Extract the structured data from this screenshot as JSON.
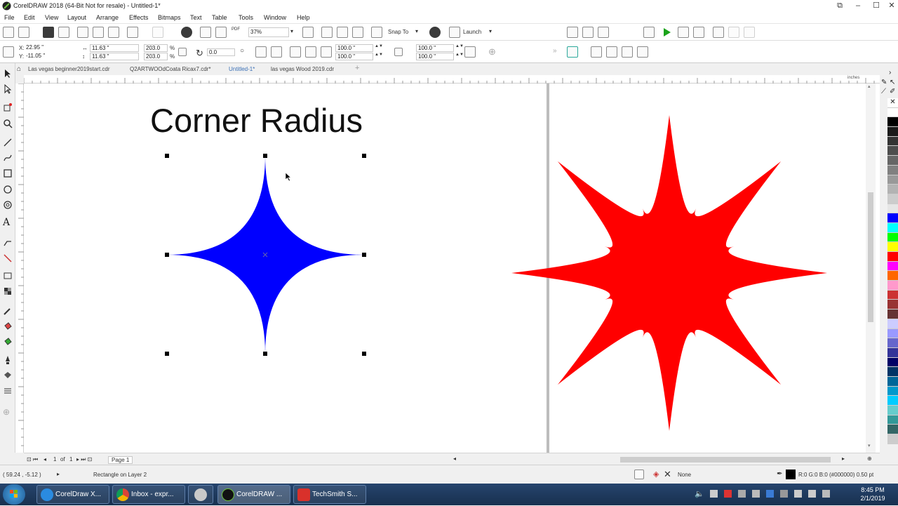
{
  "window": {
    "title": "CorelDRAW 2018 (64-Bit Not for resale) - Untitled-1*"
  },
  "menu": [
    "File",
    "Edit",
    "View",
    "Layout",
    "Arrange",
    "Effects",
    "Bitmaps",
    "Text",
    "Table",
    "Tools",
    "Window",
    "Help"
  ],
  "standard_toolbar": {
    "zoom": "37%",
    "snap_to": "Snap To",
    "launch": "Launch",
    "pdf_label": "PDF"
  },
  "property_bar": {
    "x": "22.95 \"",
    "y": "-11.05 \"",
    "width": "11.63 \"",
    "height": "11.63 \"",
    "scale_w": "203.0",
    "scale_h": "203.0",
    "percent": "%",
    "rotation": "0.0",
    "corner_a": "100.0 \"",
    "corner_b": "100.0 \"",
    "corner_c": "100.0 \"",
    "corner_d": "100.0 \""
  },
  "doc_tabs": [
    "Las vegas beginner2019start.cdr",
    "Q2ARTWOOdCoata Ricax7.cdr*",
    "Untitled-1*",
    "las vegas Wood 2019.cdr"
  ],
  "ruler_labels": [
    "inches"
  ],
  "canvas": {
    "heading": "Corner Radius",
    "left_shape_color": "#0000ff",
    "right_shape_color": "#ff0000"
  },
  "page_nav": {
    "current": "1",
    "of": "of",
    "total": "1",
    "page_tab": "Page 1"
  },
  "status": {
    "coords": "( 59.24 , -5.12 )",
    "object": "Rectangle on Layer 2",
    "fill": "None",
    "outline": "R:0 G:0 B:0 (#000000)  0.50 pt"
  },
  "taskbar": {
    "items": [
      "CorelDraw X...",
      "Inbox - expr...",
      "CorelDRAW ...",
      "TechSmith S..."
    ],
    "time": "8:45 PM",
    "date": "2/1/2019"
  },
  "palette": [
    "#ffffff",
    "#000000",
    "#1a1a1a",
    "#333333",
    "#4d4d4d",
    "#666666",
    "#808080",
    "#999999",
    "#b3b3b3",
    "#cccccc",
    "#e6e6e6",
    "#0000ff",
    "#00ffff",
    "#00ff00",
    "#ffff00",
    "#ff0000",
    "#ff00ff",
    "#ff6600",
    "#ff99cc",
    "#cc3333",
    "#993333",
    "#663333",
    "#ccccff",
    "#9999ff",
    "#6666cc",
    "#333399",
    "#000066",
    "#003366",
    "#006699",
    "#0099cc",
    "#00ccff",
    "#66cccc",
    "#339999",
    "#336666",
    "#cccccc"
  ]
}
